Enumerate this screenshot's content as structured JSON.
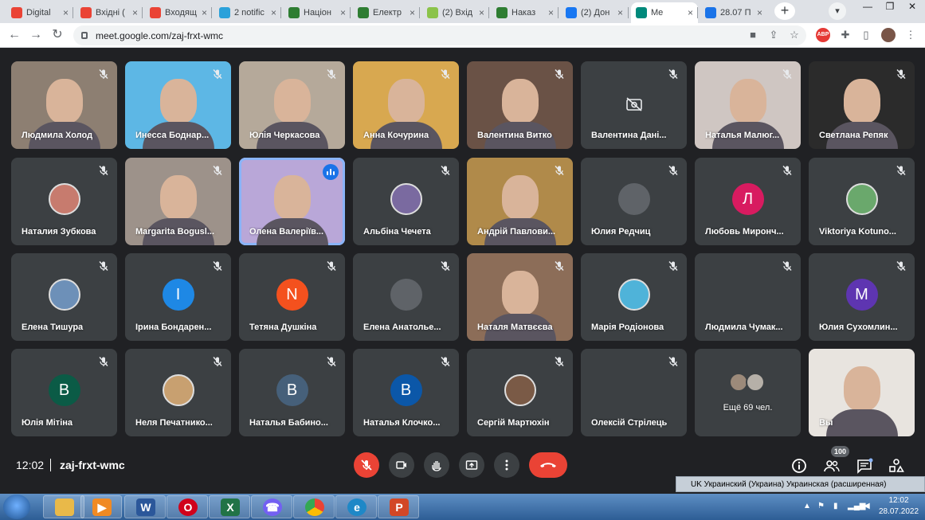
{
  "browser": {
    "tabs": [
      {
        "label": "Digital",
        "icon": "gmail-icon",
        "color": "#ea4335"
      },
      {
        "label": "Вхідні (",
        "icon": "gmail-icon",
        "color": "#ea4335"
      },
      {
        "label": "Входящ",
        "icon": "gmail-icon",
        "color": "#ea4335"
      },
      {
        "label": "2 notific",
        "icon": "telegram-icon",
        "color": "#2aa1da"
      },
      {
        "label": "Націон",
        "icon": "site-icon",
        "color": "#2e7d32"
      },
      {
        "label": "Електр",
        "icon": "site-icon",
        "color": "#2e7d32"
      },
      {
        "label": "(2) Вхід",
        "icon": "mail-icon",
        "color": "#8bc34a"
      },
      {
        "label": "Наказ",
        "icon": "site-icon",
        "color": "#2e7d32"
      },
      {
        "label": "(2) Дон",
        "icon": "facebook-icon",
        "color": "#1877f2"
      },
      {
        "label": "Me",
        "icon": "meet-icon",
        "color": "#00897b"
      },
      {
        "label": "28.07 П",
        "icon": "site-icon",
        "color": "#1a73e8"
      }
    ],
    "url": "meet.google.com/zaj-frxt-wmc"
  },
  "participants": [
    {
      "name": "Людмила Холод",
      "type": "video",
      "bg": "#8d7f72"
    },
    {
      "name": "Инесса Боднар...",
      "type": "video",
      "bg": "#5db7e5"
    },
    {
      "name": "Юлія Черкасова",
      "type": "video",
      "bg": "#b5a99a"
    },
    {
      "name": "Анна Кочурина",
      "type": "video",
      "bg": "#d8a850"
    },
    {
      "name": "Валентина Витко",
      "type": "video",
      "bg": "#6a5246"
    },
    {
      "name": "Валентина Дані...",
      "type": "camoff",
      "bg": "#3c4043"
    },
    {
      "name": "Наталья Малюг...",
      "type": "video",
      "bg": "#cfc6c2"
    },
    {
      "name": "Светлана Репяк",
      "type": "video",
      "bg": "#2b2b2b"
    },
    {
      "name": "Наталия Зубкова",
      "type": "photo",
      "bg": "#c77b6e"
    },
    {
      "name": "Margarita Bogusl...",
      "type": "video",
      "bg": "#9d928a"
    },
    {
      "name": "Олена Валеріїв...",
      "type": "video",
      "bg": "#b9a7d8",
      "speaking": true
    },
    {
      "name": "Альбіна Чечета",
      "type": "photo",
      "bg": "#7a6aa0"
    },
    {
      "name": "Андрій Павлови...",
      "type": "video",
      "bg": "#b08a4a"
    },
    {
      "name": "Юлия Редчиц",
      "type": "blank",
      "bg": "#5f6368"
    },
    {
      "name": "Любовь Мирон­ч...",
      "type": "letter",
      "letter": "Л",
      "bg": "#d81b60"
    },
    {
      "name": "Viktoriya Kotuno...",
      "type": "photo",
      "bg": "#6aa86c"
    },
    {
      "name": "Елена Тишура",
      "type": "photo",
      "bg": "#6d90b8"
    },
    {
      "name": "Ірина Бондарен...",
      "type": "letter",
      "letter": "І",
      "bg": "#1e88e5"
    },
    {
      "name": "Тетяна Душкіна",
      "type": "letter",
      "letter": "N",
      "bg": "#f4511e"
    },
    {
      "name": "Елена Анатолье...",
      "type": "blank",
      "bg": "#5f6368"
    },
    {
      "name": "Наталя Матвєєва",
      "type": "video",
      "bg": "#8c6d58"
    },
    {
      "name": "Марія Родіонова",
      "type": "photo",
      "bg": "#4fb3d9"
    },
    {
      "name": "Людмила Чумак...",
      "type": "none",
      "bg": "#3c4043"
    },
    {
      "name": "Юлия Сухомлин...",
      "type": "letter",
      "letter": "M",
      "bg": "#5e35b1"
    },
    {
      "name": "Юлія Мітіна",
      "type": "letter",
      "letter": "В",
      "bg": "#0b5b46"
    },
    {
      "name": "Неля Печатнико...",
      "type": "photo",
      "bg": "#c8a070"
    },
    {
      "name": "Наталья Бабино...",
      "type": "letter",
      "letter": "В",
      "bg": "#46607a"
    },
    {
      "name": "Наталья Клочко...",
      "type": "letter",
      "letter": "В",
      "bg": "#0b57a8"
    },
    {
      "name": "Сергій Мартюхін",
      "type": "photo",
      "bg": "#7a5a46"
    },
    {
      "name": "Олексій Стрілець",
      "type": "none",
      "bg": "#3c4043"
    },
    {
      "name": "Ещё 69 чел.",
      "type": "more",
      "bg": "#3c4043"
    },
    {
      "name": "Вы",
      "type": "self",
      "bg": "#e8e4df"
    }
  ],
  "controls": {
    "time": "12:02",
    "meeting_code": "zaj-frxt-wmc",
    "participant_badge": "100"
  },
  "windows": {
    "lang_bar": "UK Украинский (Украина)   Украинская (расширенная)",
    "tray_time": "12:02",
    "tray_date": "28.07.2022"
  }
}
